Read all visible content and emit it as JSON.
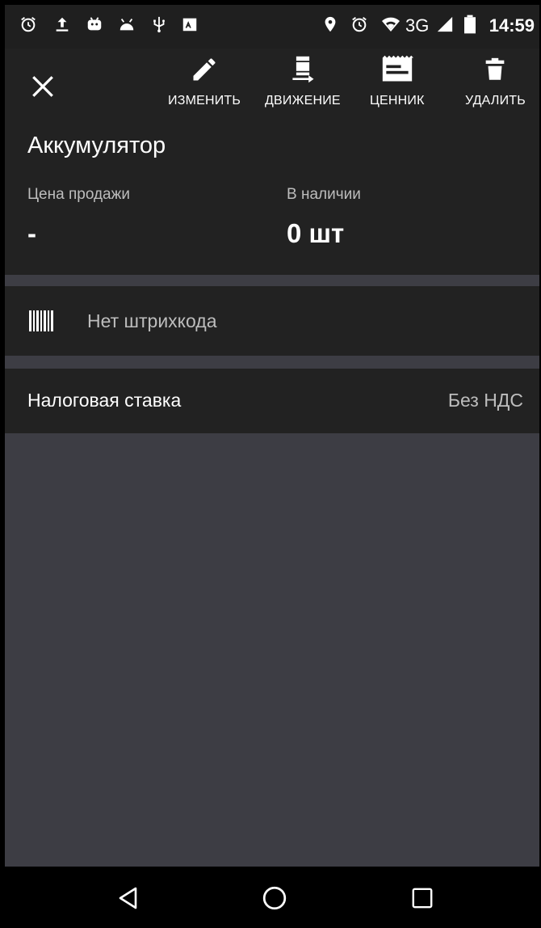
{
  "status_bar": {
    "network": "3G",
    "time": "14:59",
    "left_icons": [
      "alarm-icon",
      "upload-icon",
      "android-icon",
      "android-head-icon",
      "usb-icon",
      "photo-icon"
    ],
    "right_icons": [
      "location-pin-icon",
      "alarm-icon",
      "wifi-icon",
      "signal-icon",
      "battery-icon"
    ]
  },
  "toolbar": {
    "close_icon": "close-icon",
    "actions": [
      {
        "label": "ИЗМЕНИТЬ",
        "icon": "pencil-icon"
      },
      {
        "label": "ДВИЖЕНИЕ",
        "icon": "movement-icon"
      },
      {
        "label": "ЦЕННИК",
        "icon": "price-tag-icon"
      },
      {
        "label": "УДАЛИТЬ",
        "icon": "trash-icon"
      }
    ]
  },
  "product": {
    "name": "Аккумулятор",
    "price_label": "Цена продажи",
    "price_value": "-",
    "stock_label": "В наличии",
    "stock_value": "0 шт"
  },
  "barcode": {
    "icon": "barcode-icon",
    "text": "Нет штрихкода"
  },
  "tax": {
    "label": "Налоговая ставка",
    "value": "Без НДС"
  },
  "nav_bar": {
    "buttons": [
      "back-icon",
      "home-icon",
      "recents-icon"
    ]
  },
  "colors": {
    "panel": "#222222",
    "background": "#3d3d44",
    "status_bar": "#1f1f1f",
    "text_primary": "#ffffff",
    "text_secondary": "#bdbdbd"
  }
}
